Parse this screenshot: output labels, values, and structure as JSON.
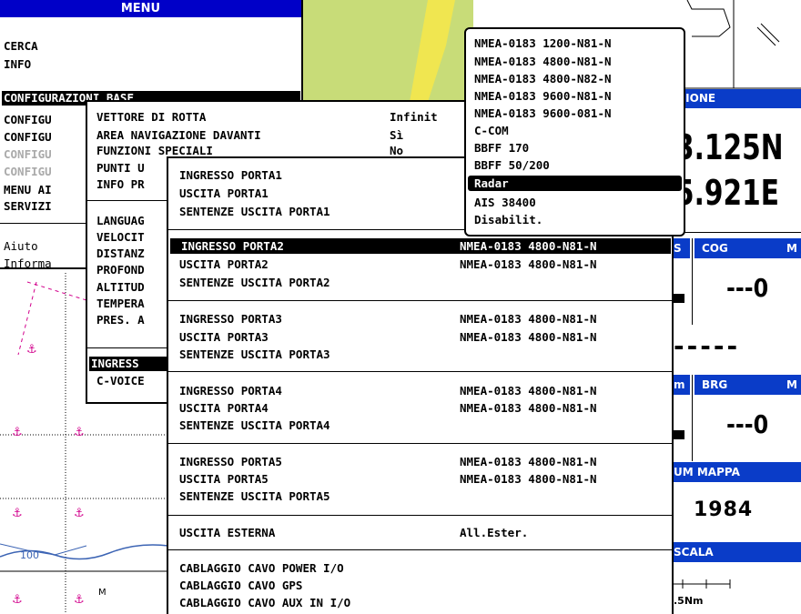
{
  "main_menu": {
    "title": "MENU",
    "items": [
      "CERCA",
      "INFO",
      "CONFIGURAZIONI BASE",
      "CONFIGU",
      "CONFIGU",
      "CONFIGU",
      "CONFIGU",
      "MENU AI",
      "SERVIZI",
      "Aiuto",
      "Informa"
    ]
  },
  "config_menu": {
    "rows": [
      {
        "label": "VETTORE DI ROTTA",
        "value": "Infinit"
      },
      {
        "label": "AREA NAVIGAZIONE DAVANTI",
        "value": "Sì"
      },
      {
        "label": "FUNZIONI SPECIALI",
        "value": "No"
      },
      {
        "label": "PUNTI U",
        "value": ""
      },
      {
        "label": "INFO PR",
        "value": ""
      },
      {
        "label": "LANGUAG",
        "value": ""
      },
      {
        "label": "VELOCIT",
        "value": ""
      },
      {
        "label": "DISTANZ",
        "value": ""
      },
      {
        "label": "PROFOND",
        "value": ""
      },
      {
        "label": "ALTITUD",
        "value": ""
      },
      {
        "label": "TEMPERA",
        "value": ""
      },
      {
        "label": "PRES. A",
        "value": ""
      },
      {
        "label": "INGRESS",
        "value": ""
      },
      {
        "label": "C-VOICE",
        "value": ""
      }
    ]
  },
  "ports_menu": {
    "groups": [
      {
        "rows": [
          {
            "label": "INGRESSO PORTA1",
            "value": ""
          },
          {
            "label": "USCITA PORTA1",
            "value": ""
          },
          {
            "label": "SENTENZE USCITA PORTA1",
            "value": ""
          }
        ]
      },
      {
        "rows": [
          {
            "label": "INGRESSO PORTA2",
            "value": "NMEA-0183 4800-N81-N"
          },
          {
            "label": "USCITA PORTA2",
            "value": "NMEA-0183 4800-N81-N"
          },
          {
            "label": "SENTENZE USCITA PORTA2",
            "value": ""
          }
        ]
      },
      {
        "rows": [
          {
            "label": "INGRESSO PORTA3",
            "value": "NMEA-0183 4800-N81-N"
          },
          {
            "label": "USCITA PORTA3",
            "value": "NMEA-0183 4800-N81-N"
          },
          {
            "label": "SENTENZE USCITA PORTA3",
            "value": ""
          }
        ]
      },
      {
        "rows": [
          {
            "label": "INGRESSO PORTA4",
            "value": "NMEA-0183 4800-N81-N"
          },
          {
            "label": "USCITA PORTA4",
            "value": "NMEA-0183 4800-N81-N"
          },
          {
            "label": "SENTENZE USCITA PORTA4",
            "value": ""
          }
        ]
      },
      {
        "rows": [
          {
            "label": "INGRESSO PORTA5",
            "value": "NMEA-0183 4800-N81-N"
          },
          {
            "label": "USCITA PORTA5",
            "value": "NMEA-0183 4800-N81-N"
          },
          {
            "label": "SENTENZE USCITA PORTA5",
            "value": ""
          }
        ]
      },
      {
        "rows": [
          {
            "label": "USCITA ESTERNA",
            "value": "All.Ester."
          }
        ]
      },
      {
        "rows": [
          {
            "label": "CABLAGGIO CAVO POWER I/O",
            "value": ""
          },
          {
            "label": "CABLAGGIO CAVO GPS",
            "value": ""
          },
          {
            "label": "CABLAGGIO CAVO AUX IN I/O",
            "value": ""
          }
        ]
      }
    ]
  },
  "options_popup": {
    "options": [
      "NMEA-0183 1200-N81-N",
      "NMEA-0183 4800-N81-N",
      "NMEA-0183 4800-N82-N",
      "NMEA-0183 9600-N81-N",
      "NMEA-0183 9600-081-N",
      "C-COM",
      "BBFF 170",
      "BBFF 50/200",
      "Radar",
      "AIS 38400",
      "Disabilit."
    ],
    "selected": "Radar"
  },
  "right_panel": {
    "position_header": "IZIONE",
    "lat": "3.125N",
    "lon": "5.921E",
    "cog_label": "COG",
    "cog_value": "---0",
    "s_label": "S",
    "m_label": "M",
    "brg_label": "BRG",
    "brg_value": "---0",
    "mid_value": "-----",
    "m_label2": "m",
    "datum_header": "UM MAPPA",
    "datum_value": "1984",
    "scale_header": "SCALA",
    "scale_value": ".5Nm"
  },
  "chart": {
    "depth_label": "100",
    "m_label": "M"
  },
  "colors": {
    "title_blue": "#0000c8",
    "header_blue": "#0a3cc8",
    "map_green": "#c8dc78",
    "map_yellow": "#f0e650",
    "anchor": "#d2008c"
  }
}
